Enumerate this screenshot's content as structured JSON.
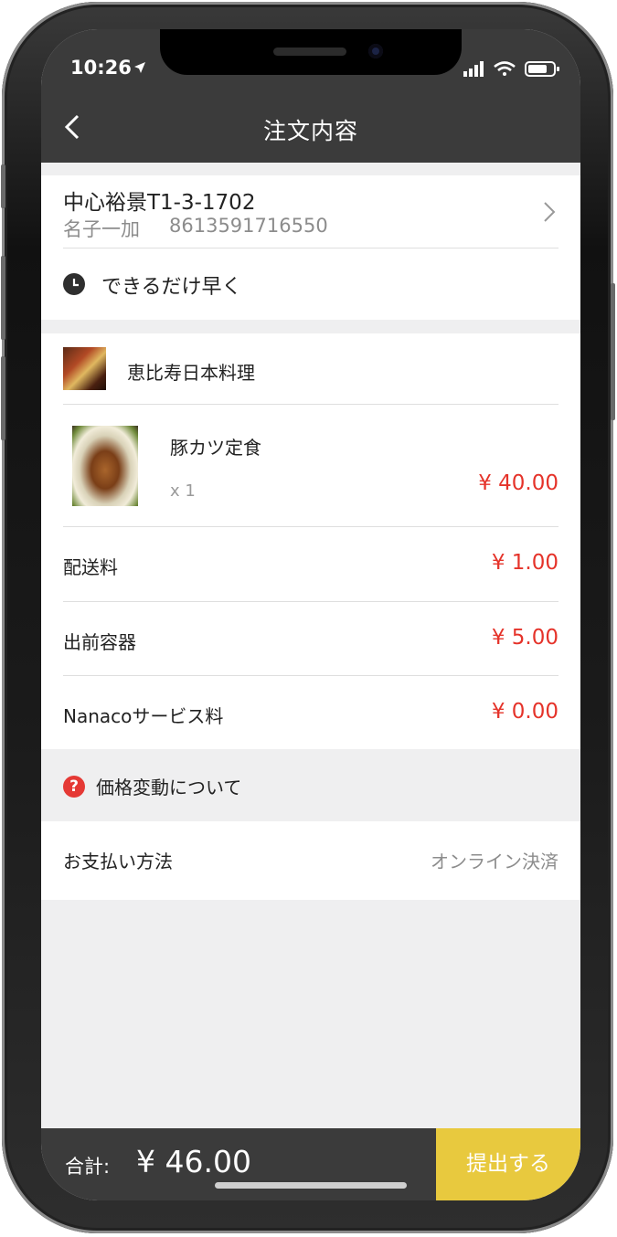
{
  "status_bar": {
    "time": "10:26"
  },
  "header": {
    "title": "注文内容"
  },
  "address": {
    "line": "中心裕景T1-3-1702",
    "name": "名子一加",
    "phone": "8613591716550"
  },
  "delivery_time": {
    "label": "できるだけ早く"
  },
  "shop": {
    "name": "恵比寿日本料理"
  },
  "item": {
    "name": "豚カツ定食",
    "qty": "x 1",
    "price": "¥ 40.00"
  },
  "fees": [
    {
      "label": "配送料",
      "value": "¥ 1.00"
    },
    {
      "label": "出前容器",
      "value": "¥ 5.00"
    },
    {
      "label": "Nanacoサービス料",
      "value": "¥ 0.00"
    }
  ],
  "price_notice": {
    "label": "価格変動について"
  },
  "payment": {
    "label": "お支払い方法",
    "value": "オンライン決済"
  },
  "footer": {
    "total_label": "合計:",
    "total_value": "¥ 46.00",
    "submit_label": "提出する"
  },
  "colors": {
    "header_bg": "#3b3b3b",
    "price_red": "#e5332a",
    "submit_yellow": "#e8c93e",
    "screen_bg": "#efeff0"
  }
}
